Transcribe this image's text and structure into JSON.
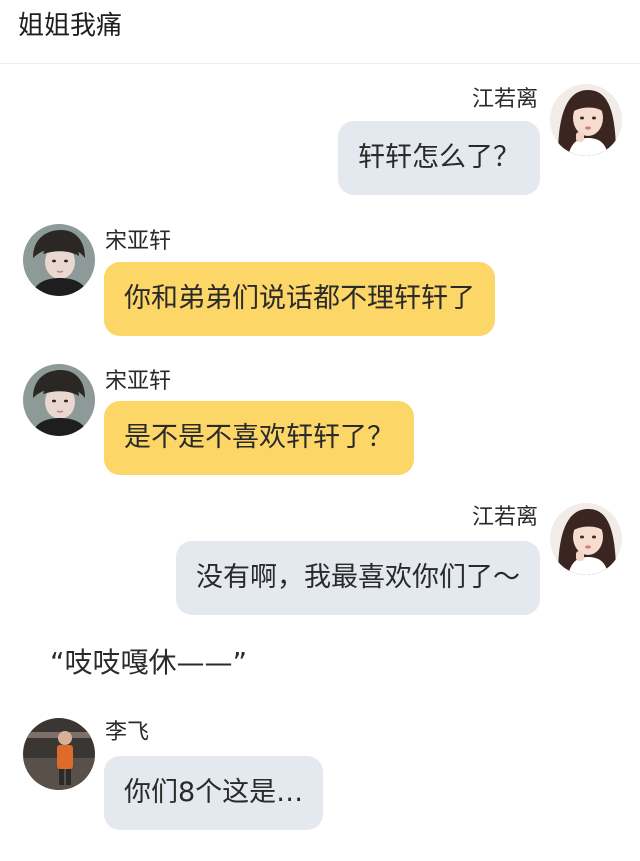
{
  "header": {
    "title": "姐姐我痛"
  },
  "messages": [
    {
      "sender": "江若离",
      "text": "轩轩怎么了？",
      "side": "right",
      "avatar_icon": "girl-avatar-icon",
      "bubble_color": "#e3e9ef"
    },
    {
      "sender": "宋亚轩",
      "text": "你和弟弟们说话都不理轩轩了",
      "side": "left",
      "avatar_icon": "boy-avatar-icon",
      "bubble_color": "#fcd666"
    },
    {
      "sender": "宋亚轩",
      "text": "是不是不喜欢轩轩了？",
      "side": "left",
      "avatar_icon": "boy-avatar-icon",
      "bubble_color": "#fcd666"
    },
    {
      "sender": "江若离",
      "text": "没有啊，我最喜欢你们了～",
      "side": "right",
      "avatar_icon": "girl-avatar-icon",
      "bubble_color": "#e3e9ef"
    },
    {
      "sender": "李飞",
      "text": "你们8个这是…",
      "side": "left",
      "avatar_icon": "man-avatar-icon",
      "bubble_color": "#e3e9ef"
    }
  ],
  "narration": "“吱吱嘎休——”"
}
